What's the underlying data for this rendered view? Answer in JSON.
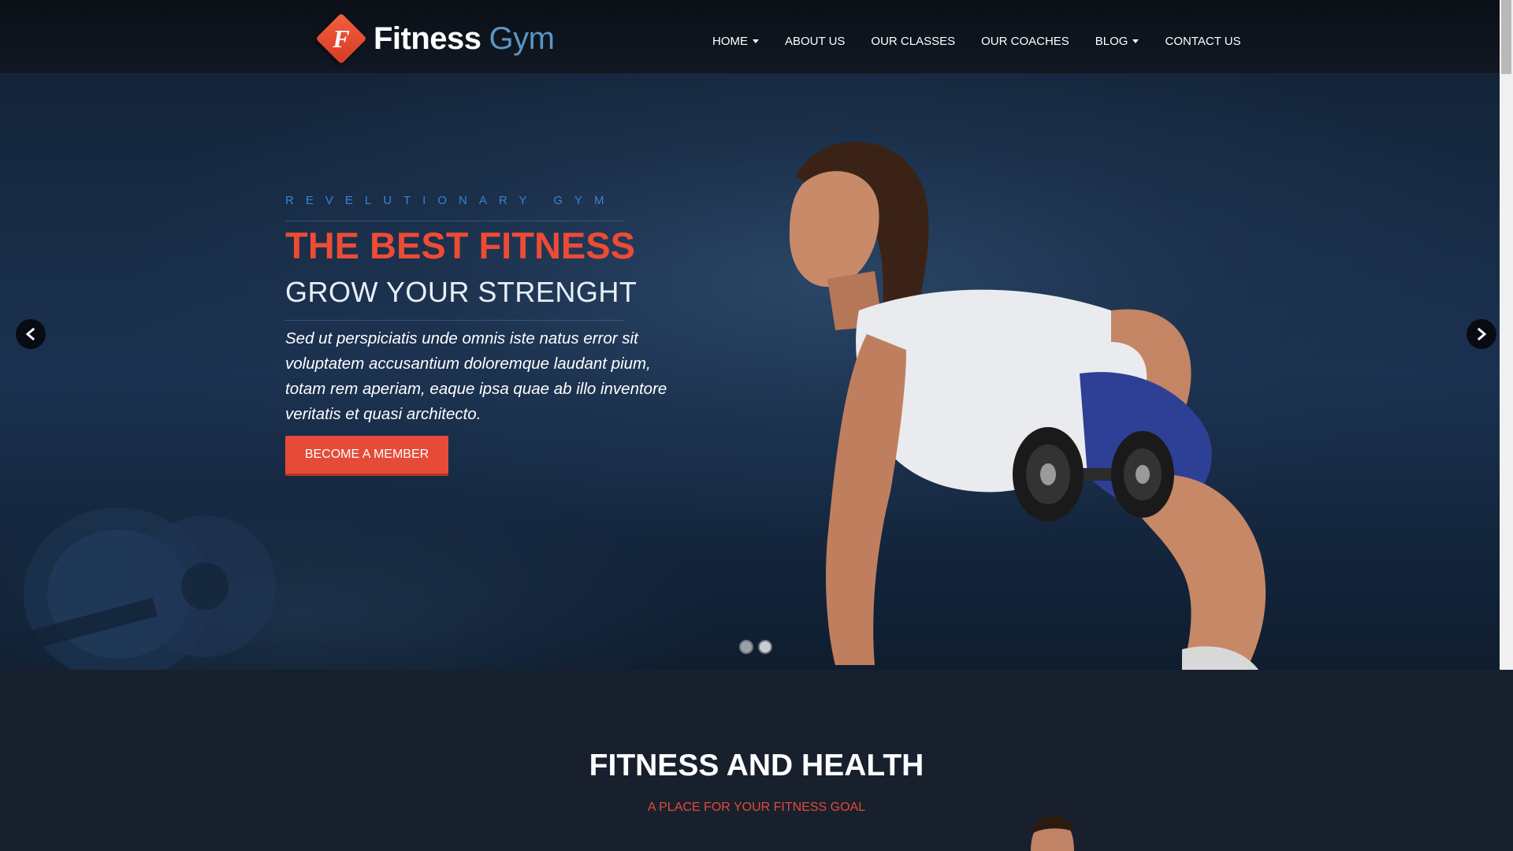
{
  "brand": {
    "logo_letter": "F",
    "name_part1": "Fitness",
    "name_part2": "Gym",
    "accent_color": "#e54b38",
    "secondary_color": "#5b94c4"
  },
  "nav": {
    "items": [
      {
        "label": "HOME",
        "dropdown": true
      },
      {
        "label": "ABOUT US",
        "dropdown": false
      },
      {
        "label": "OUR CLASSES",
        "dropdown": false
      },
      {
        "label": "OUR COACHES",
        "dropdown": false
      },
      {
        "label": "BLOG",
        "dropdown": true
      },
      {
        "label": "CONTACT US",
        "dropdown": false
      }
    ]
  },
  "hero": {
    "eyebrow": "REVELUTIONARY GYM",
    "headline": "THE BEST FITNESS",
    "subheadline": "GROW YOUR STRENGHT",
    "lead": "Sed ut perspiciatis unde omnis iste natus error sit voluptatem accusantium doloremque laudant pium, totam rem aperiam, eaque ipsa quae ab illo inventore veritatis et quasi architecto.",
    "cta_label": "BECOME A MEMBER",
    "prev_icon": "chevron-left-icon",
    "next_icon": "chevron-right-icon",
    "slides_total": 2,
    "active_slide": 1
  },
  "section": {
    "title": "FITNESS AND HEALTH",
    "subtitle": "A PLACE FOR YOUR FITNESS GOAL"
  }
}
